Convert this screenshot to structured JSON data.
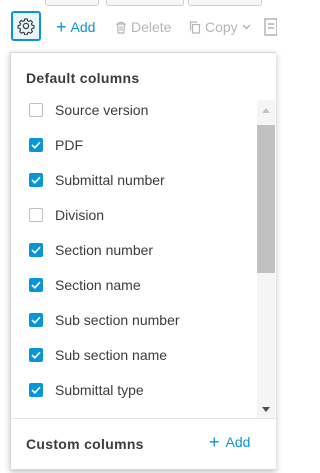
{
  "toolbar": {
    "settings_icon": "gear-icon",
    "add_label": "Add",
    "delete_label": "Delete",
    "copy_label": "Copy"
  },
  "columns_panel": {
    "default_title": "Default columns",
    "items": [
      {
        "label": "Source version",
        "checked": false
      },
      {
        "label": "PDF",
        "checked": true
      },
      {
        "label": "Submittal number",
        "checked": true
      },
      {
        "label": "Division",
        "checked": false
      },
      {
        "label": "Section number",
        "checked": true
      },
      {
        "label": "Section name",
        "checked": true
      },
      {
        "label": "Sub section number",
        "checked": true
      },
      {
        "label": "Sub section name",
        "checked": true
      },
      {
        "label": "Submittal type",
        "checked": true
      }
    ],
    "custom_title": "Custom columns",
    "custom_add_label": "Add"
  },
  "colors": {
    "accent": "#0696d7",
    "disabled": "#b5b5b5",
    "text": "#3c3c3c"
  }
}
